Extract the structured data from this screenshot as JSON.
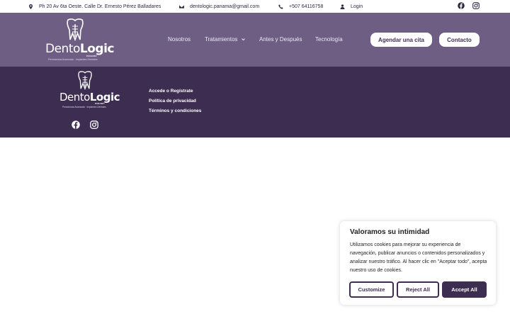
{
  "topbar": {
    "address": "Ph 20 Av 6ta Oeste. Calle Dr. Ernesto Pérez Balladares",
    "email": "dentologic.panama@gmail.com",
    "phone": "+507 64116758",
    "login": "Login",
    "icons": [
      "location-pin-icon",
      "envelope-icon",
      "phone-icon",
      "user-icon",
      "facebook-icon",
      "instagram-icon"
    ]
  },
  "brand": {
    "name_light": "Dento",
    "name_bold": "Logic",
    "country": "PANAMÁ",
    "tagline": "Periodoncia Avanzada · Implantes Dentales"
  },
  "nav": {
    "links": [
      "Nosotros",
      "Tratamientos",
      "Antes y Después",
      "Tecnología"
    ],
    "cta": "Agendar una cita",
    "contact": "Contacto"
  },
  "footer": {
    "links": [
      "Accede o Regístrate",
      "Política de privacidad",
      "Términos y condiciones"
    ]
  },
  "cookie": {
    "title": "Valoramos su intimidad",
    "body": "Utilizamos cookies para mejorar su experiencia de navegación, publicar anuncios o contenidos personalizados y analizar nuestro tráfico. Al hacer clic en \"Aceptar todo\", acepta nuestro uso de cookies.",
    "customize": "Customize",
    "reject": "Reject All",
    "accept": "Accept All"
  },
  "colors": {
    "nav_bg": "#6e5e83",
    "footer_bg": "#3c2d51",
    "accent": "#3c2d51",
    "white": "#ffffff"
  }
}
